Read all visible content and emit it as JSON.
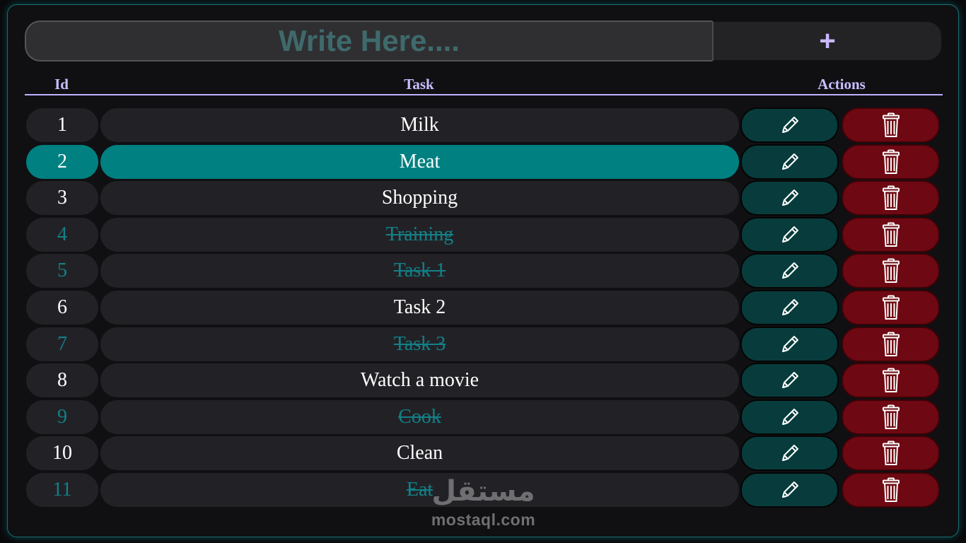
{
  "input": {
    "placeholder": "Write Here....",
    "add_label": "+"
  },
  "table": {
    "headers": {
      "id": "Id",
      "task": "Task",
      "actions": "Actions"
    },
    "rows": [
      {
        "id": "1",
        "task": "Milk",
        "done": false,
        "selected": false
      },
      {
        "id": "2",
        "task": "Meat",
        "done": false,
        "selected": true
      },
      {
        "id": "3",
        "task": "Shopping",
        "done": false,
        "selected": false
      },
      {
        "id": "4",
        "task": "Training",
        "done": true,
        "selected": false
      },
      {
        "id": "5",
        "task": "Task 1",
        "done": true,
        "selected": false
      },
      {
        "id": "6",
        "task": "Task 2",
        "done": false,
        "selected": false
      },
      {
        "id": "7",
        "task": "Task 3",
        "done": true,
        "selected": false
      },
      {
        "id": "8",
        "task": "Watch a movie",
        "done": false,
        "selected": false
      },
      {
        "id": "9",
        "task": "Cook",
        "done": true,
        "selected": false
      },
      {
        "id": "10",
        "task": "Clean",
        "done": false,
        "selected": false
      },
      {
        "id": "11",
        "task": "Eat",
        "done": true,
        "selected": false
      }
    ]
  },
  "actions": {
    "edit_icon": "pencil-icon",
    "delete_icon": "trash-icon"
  },
  "watermark": {
    "logo": "مستقل",
    "url": "mostaql.com"
  },
  "colors": {
    "accent_teal": "#008080",
    "done_text": "#128087",
    "edit_button": "#083c3c",
    "delete_button": "#6e0812",
    "header_text": "#c9bfff"
  }
}
